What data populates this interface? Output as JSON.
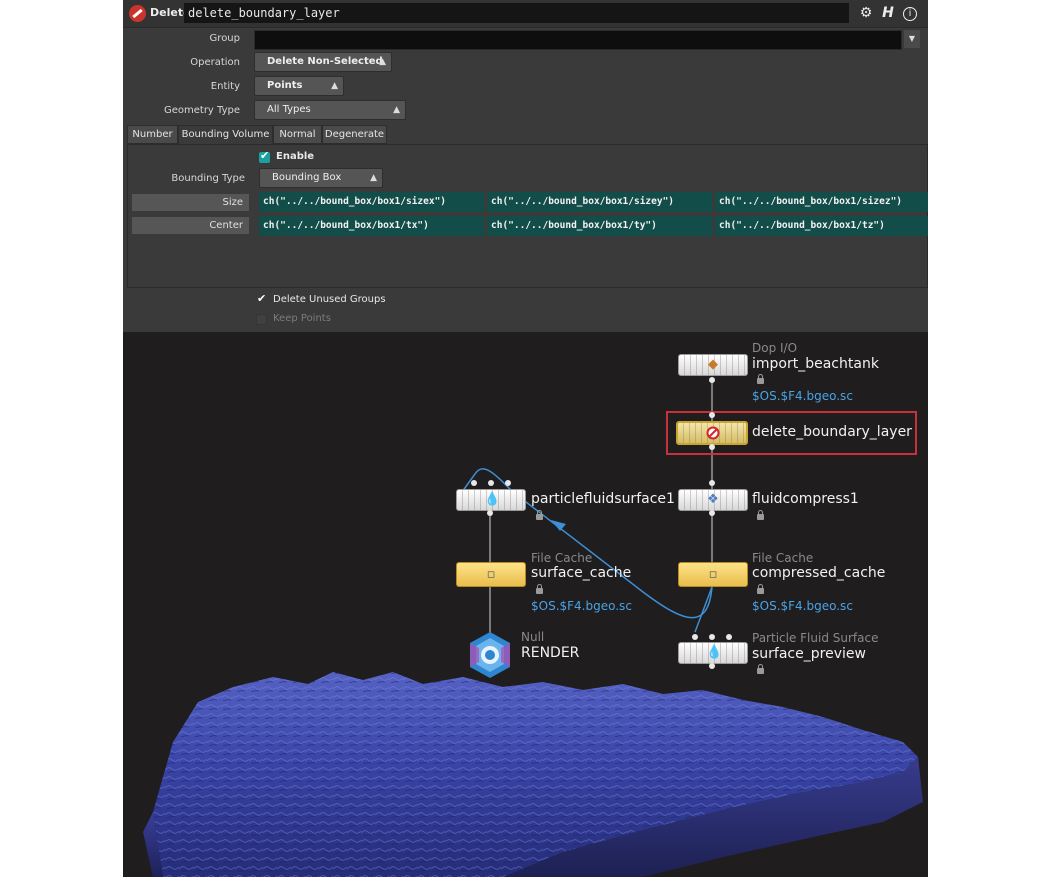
{
  "title_bar": {
    "node_type": "Delete",
    "node_name": "delete_boundary_layer",
    "icons": [
      "gear-icon",
      "houdini-help-icon",
      "info-icon"
    ]
  },
  "params": {
    "group_label": "Group",
    "group_value": "",
    "operation_label": "Operation",
    "operation_value": "Delete Non-Selected",
    "entity_label": "Entity",
    "entity_value": "Points",
    "geometry_type_label": "Geometry Type",
    "geometry_type_value": "All Types"
  },
  "tabs": [
    {
      "label": "Number"
    },
    {
      "label": "Bounding Volume"
    },
    {
      "label": "Normal"
    },
    {
      "label": "Degenerate"
    }
  ],
  "bounding": {
    "enable_label": "Enable",
    "bounding_type_label": "Bounding Type",
    "bounding_type_value": "Bounding Box",
    "size_label": "Size",
    "size_values": [
      "ch(\"../../bound_box/box1/sizex\")",
      "ch(\"../../bound_box/box1/sizey\")",
      "ch(\"../../bound_box/box1/sizez\")"
    ],
    "center_label": "Center",
    "center_values": [
      "ch(\"../../bound_box/box1/tx\")",
      "ch(\"../../bound_box/box1/ty\")",
      "ch(\"../../bound_box/box1/tz\")"
    ]
  },
  "options": {
    "delete_unused_groups": "Delete Unused Groups",
    "keep_points": "Keep Points"
  },
  "network": {
    "import_beachtank": {
      "type": "Dop I/O",
      "name": "import_beachtank",
      "path": "$OS.$F4.bgeo.sc"
    },
    "delete_boundary_layer": {
      "name": "delete_boundary_layer"
    },
    "fluidcompress1": {
      "name": "fluidcompress1"
    },
    "compressed_cache": {
      "type": "File Cache",
      "name": "compressed_cache",
      "path": "$OS.$F4.bgeo.sc"
    },
    "surface_preview": {
      "type": "Particle Fluid Surface",
      "name": "surface_preview"
    },
    "particlefluidsurface1": {
      "name": "particlefluidsurface1"
    },
    "surface_cache": {
      "type": "File Cache",
      "name": "surface_cache",
      "path": "$OS.$F4.bgeo.sc"
    },
    "render": {
      "type": "Null",
      "name": "RENDER"
    }
  },
  "colors": {
    "highlight": "#c8303a",
    "wire_selected": "#3d8fd6",
    "fluid_surface": "#3a46a8"
  }
}
